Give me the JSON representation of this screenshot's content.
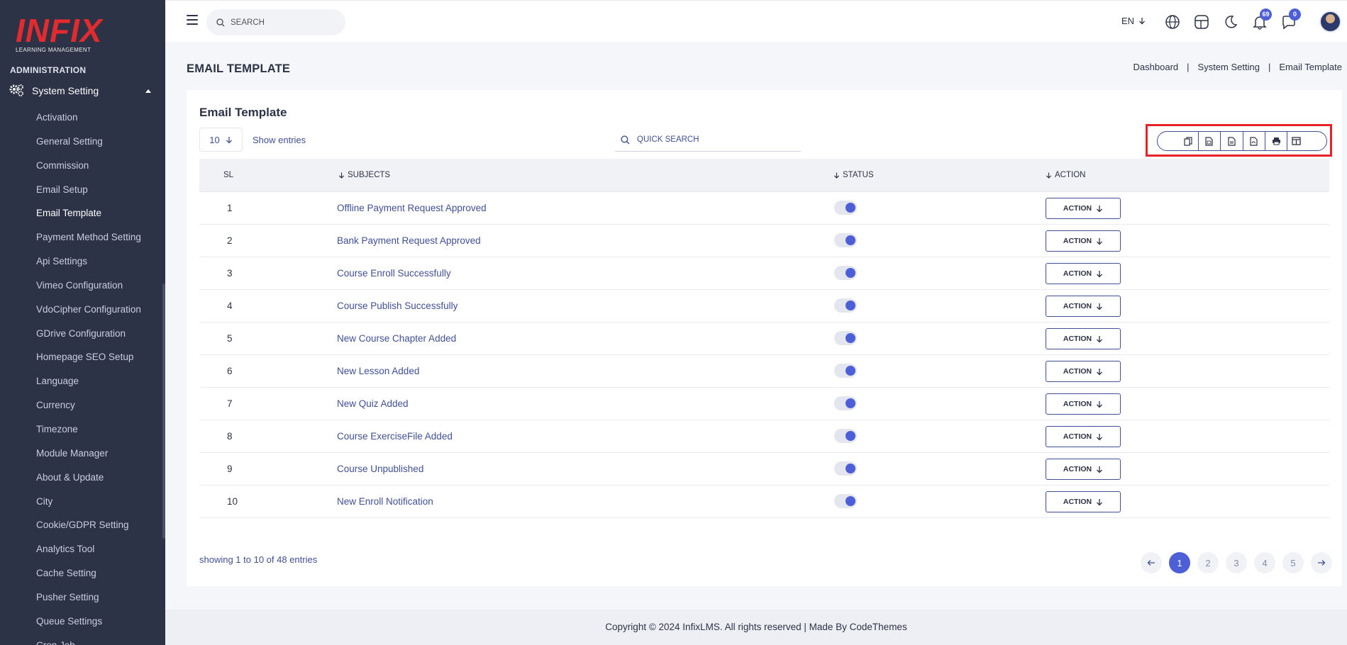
{
  "brand": {
    "logo_text": "INFIX",
    "logo_sub": "LEARNING MANAGEMENT",
    "color": "#e32a2e"
  },
  "sidebar": {
    "section_heading": "ADMINISTRATION",
    "group_label": "System Setting",
    "group_icon": "gears-icon",
    "items": [
      {
        "label": "Activation"
      },
      {
        "label": "General Setting"
      },
      {
        "label": "Commission"
      },
      {
        "label": "Email Setup"
      },
      {
        "label": "Email Template",
        "active": true
      },
      {
        "label": "Payment Method Setting"
      },
      {
        "label": "Api Settings"
      },
      {
        "label": "Vimeo Configuration"
      },
      {
        "label": "VdoCipher Configuration"
      },
      {
        "label": "GDrive Configuration"
      },
      {
        "label": "Homepage SEO Setup"
      },
      {
        "label": "Language"
      },
      {
        "label": "Currency"
      },
      {
        "label": "Timezone"
      },
      {
        "label": "Module Manager"
      },
      {
        "label": "About & Update"
      },
      {
        "label": "City"
      },
      {
        "label": "Cookie/GDPR Setting"
      },
      {
        "label": "Analytics Tool"
      },
      {
        "label": "Cache Setting"
      },
      {
        "label": "Pusher Setting"
      },
      {
        "label": "Queue Settings"
      },
      {
        "label": "Cron Job"
      }
    ]
  },
  "topbar": {
    "search_placeholder": "SEARCH",
    "language": "EN",
    "notifications_count": "69",
    "messages_count": "0",
    "icons": [
      "hamburger-icon",
      "search-icon",
      "globe-icon",
      "layout-icon",
      "moon-icon",
      "bell-icon",
      "chat-icon"
    ]
  },
  "page": {
    "title": "EMAIL TEMPLATE",
    "breadcrumb": [
      "Dashboard",
      "System Setting",
      "Email Template"
    ]
  },
  "card": {
    "title": "Email Template",
    "page_length": "10",
    "show_entries_label": "Show entries",
    "quick_search_placeholder": "QUICK SEARCH",
    "export_buttons": [
      "copy-icon",
      "csv-icon",
      "excel-icon",
      "pdf-icon",
      "print-icon",
      "columns-icon"
    ],
    "columns": {
      "sl": "SL",
      "subjects": "SUBJECTS",
      "status": "STATUS",
      "action": "ACTION"
    },
    "action_label": "ACTION",
    "rows": [
      {
        "sl": "1",
        "subject": "Offline Payment Request Approved",
        "status": true
      },
      {
        "sl": "2",
        "subject": "Bank Payment Request Approved",
        "status": true
      },
      {
        "sl": "3",
        "subject": "Course Enroll Successfully",
        "status": true
      },
      {
        "sl": "4",
        "subject": "Course Publish Successfully",
        "status": true
      },
      {
        "sl": "5",
        "subject": "New Course Chapter Added",
        "status": true
      },
      {
        "sl": "6",
        "subject": "New Lesson Added",
        "status": true
      },
      {
        "sl": "7",
        "subject": "New Quiz Added",
        "status": true
      },
      {
        "sl": "8",
        "subject": "Course ExerciseFile Added",
        "status": true
      },
      {
        "sl": "9",
        "subject": "Course Unpublished",
        "status": true
      },
      {
        "sl": "10",
        "subject": "New Enroll Notification",
        "status": true
      }
    ],
    "showing_text": "showing 1 to 10 of 48 entries",
    "pages": [
      "1",
      "2",
      "3",
      "4",
      "5"
    ],
    "current_page": "1"
  },
  "footer": {
    "text": "Copyright © 2024 InfixLMS. All rights reserved | Made By CodeThemes"
  },
  "colors": {
    "sidebar_bg": "#2d3347",
    "accent": "#4d5fd6",
    "text": "#415094",
    "highlight": "#e8202a"
  }
}
